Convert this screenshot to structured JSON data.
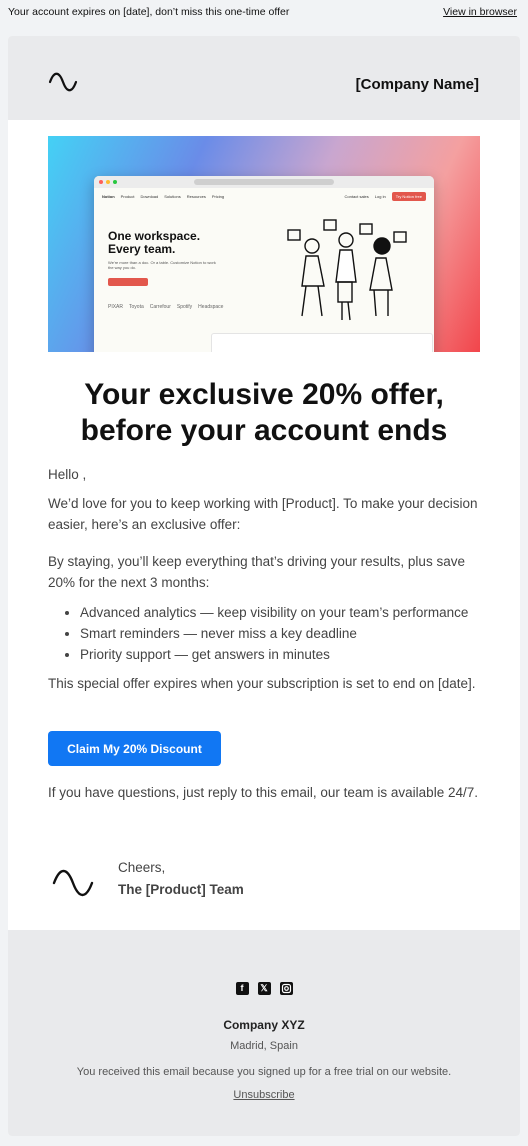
{
  "preheader": {
    "text": "Your account expires on [date], don’t miss this one-time offer",
    "view_in_browser": "View in browser"
  },
  "header": {
    "company_name": "[Company Name]",
    "logo_icon": "wave-logo-icon"
  },
  "hero": {
    "description": "Product screenshot",
    "browser": {
      "brand": "Notion",
      "nav_items": [
        "Product",
        "Download",
        "Solutions",
        "Resources",
        "Pricing"
      ],
      "nav_right": [
        "Contact sales",
        "Log in"
      ],
      "nav_cta": "Try Notion free",
      "headline_line1": "One workspace.",
      "headline_line2": "Every team.",
      "subtext": "We're more than a doc. Or a table. Customize Notion to work the way you do.",
      "logos": [
        "PIXAR",
        "Toyota",
        "Carrefour",
        "Spotify",
        "Headspace"
      ]
    }
  },
  "headline": {
    "line1": "Your exclusive 20% offer,",
    "line2": "before your account ends"
  },
  "body": {
    "greeting": "Hello ,",
    "para1": "We’d love for you to keep working with [Product]. To make your decision easier, here’s an exclusive offer:",
    "para2": "By staying, you’ll keep everything that’s driving your results, plus save 20% for the next 3 months:",
    "benefits": [
      "Advanced analytics — keep visibility on your team’s performance",
      "Smart reminders — never miss a key deadline",
      "Priority support — get answers in minutes"
    ],
    "para3": "This special offer expires when your subscription is set to end on [date].",
    "cta_label": "Claim My 20% Discount",
    "para4": "If you have questions, just reply to this email, our team is available 24/7."
  },
  "signature": {
    "cheers": "Cheers,",
    "team": "The [Product] Team"
  },
  "footer": {
    "social": [
      "facebook-icon",
      "x-icon",
      "instagram-icon"
    ],
    "company": "Company XYZ",
    "location": "Madrid, Spain",
    "note": "You received this email because you signed up for a free trial on our website.",
    "unsubscribe": "Unsubscribe"
  },
  "colors": {
    "cta": "#1177f3",
    "header_bg": "#e9eaec",
    "page_bg": "#f1f3f5"
  }
}
